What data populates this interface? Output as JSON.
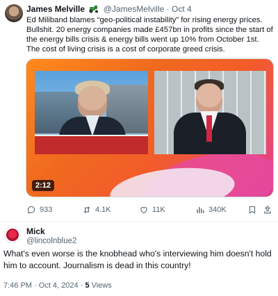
{
  "quoted_tweet": {
    "author_name": "James Melville",
    "author_emoji_icon": "tractor-emoji",
    "handle": "@JamesMelville",
    "separator": "·",
    "date": "Oct 4",
    "text": "Ed Miliband blames “geo-political instability” for rising energy prices. Bullshit. 20 energy companies made £457bn in profits since the start of the energy bills crisis & energy bills went up 10% from October 1st. The cost of living crisis is a cost of corporate greed crisis.",
    "video": {
      "duration": "2:12"
    },
    "actions": {
      "replies": "933",
      "reposts": "4.1K",
      "likes": "11K",
      "views": "340K"
    }
  },
  "reply_tweet": {
    "author_name": "Mick",
    "handle": "@lincolnblue2",
    "text": "What's even worse is the knobhead who's interviewing him doesn't hold him to account. Journalism is dead in this country!",
    "time": "7:46 PM",
    "dot": "·",
    "date": "Oct 4, 2024",
    "views_count": "5",
    "views_label": "Views"
  },
  "colors": {
    "text_primary": "#0f1419",
    "text_secondary": "#536471",
    "divider": "#eff3f4",
    "video_orange": "#f06a1e",
    "video_pink": "#e64aa0"
  }
}
